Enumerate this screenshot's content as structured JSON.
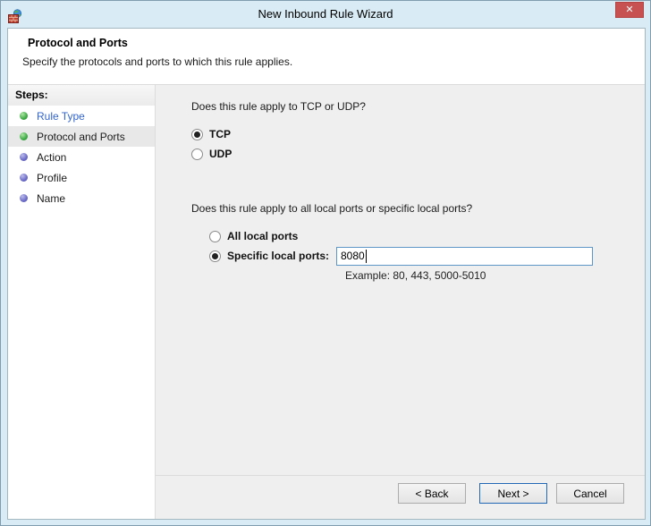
{
  "window": {
    "title": "New Inbound Rule Wizard",
    "close_glyph": "✕",
    "app_icon": "firewall-icon"
  },
  "header": {
    "title": "Protocol and Ports",
    "subtitle": "Specify the protocols and ports to which this rule applies."
  },
  "steps": {
    "label": "Steps:",
    "items": [
      {
        "label": "Rule Type",
        "state": "completed-link"
      },
      {
        "label": "Protocol and Ports",
        "state": "current"
      },
      {
        "label": "Action",
        "state": "upcoming"
      },
      {
        "label": "Profile",
        "state": "upcoming"
      },
      {
        "label": "Name",
        "state": "upcoming"
      }
    ]
  },
  "content": {
    "question1": "Does this rule apply to TCP or UDP?",
    "protocol_options": [
      {
        "label": "TCP",
        "selected": true
      },
      {
        "label": "UDP",
        "selected": false
      }
    ],
    "question2": "Does this rule apply to all local ports or specific local ports?",
    "ports_options": [
      {
        "label": "All local ports",
        "selected": false
      },
      {
        "label": "Specific local ports:",
        "selected": true
      }
    ],
    "ports_input": {
      "value": "8080"
    },
    "example": "Example: 80, 443, 5000-5010"
  },
  "footer": {
    "back_label": "< Back",
    "next_label": "Next >",
    "cancel_label": "Cancel"
  },
  "colors": {
    "titlebar_bg": "#d9ecf5",
    "window_border": "#7f9daf",
    "close_button_bg": "#c75050",
    "panel_bg": "#ffffff",
    "content_bg": "#efefef",
    "divider": "#dcdcdc",
    "step_link_text": "#3366cc",
    "step_done_bullet": "#3aa843",
    "step_pending_bullet": "#6868c6",
    "current_step_bg": "#e8e8e8",
    "input_focus_border": "#5e96c8",
    "default_button_border": "#2368b4"
  }
}
